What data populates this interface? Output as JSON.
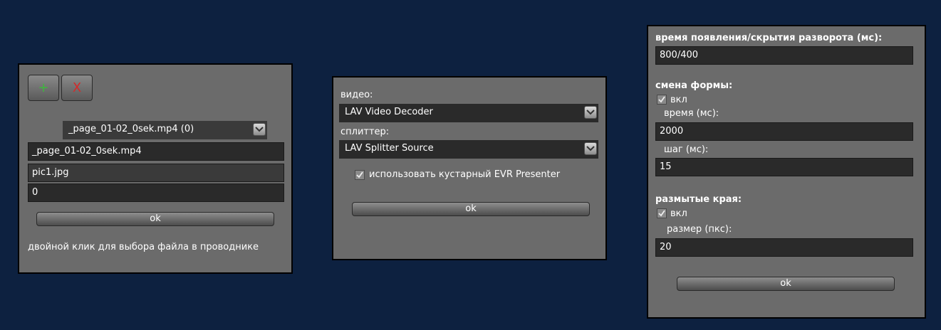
{
  "panel1": {
    "add_label": "+",
    "remove_label": "X",
    "file_combo": "_page_01-02_0sek.mp4 (0)",
    "video_field": "_page_01-02_0sek.mp4",
    "image_field": "pic1.jpg",
    "number_field": "0",
    "ok_label": "ok",
    "hint": "двойной клик для выбора файла в проводнике"
  },
  "panel2": {
    "video_label": "видео:",
    "video_decoder": "LAV Video Decoder",
    "splitter_label": "сплиттер:",
    "splitter_source": "LAV Splitter Source",
    "evr_label": "использовать кустарный EVR Presenter",
    "evr_checked": true,
    "ok_label": "ok"
  },
  "panel3": {
    "show_hide_label": "время появления/скрытия разворота (мс):",
    "show_hide_value": "800/400",
    "shape_label": "смена формы:",
    "shape_on_label": "вкл",
    "shape_time_label": "время (мс):",
    "shape_time_value": "2000",
    "shape_step_label": "шаг (мс):",
    "shape_step_value": "15",
    "blur_label": "размытые края:",
    "blur_on_label": "вкл",
    "blur_size_label": "размер (пкс):",
    "blur_size_value": "20",
    "ok_label": "ok"
  },
  "colors": {
    "background": "#0d2140",
    "panel": "#6b6b6b",
    "field": "#2a2a2a",
    "add_green": "#3db83d",
    "remove_red": "#d42a2a"
  }
}
